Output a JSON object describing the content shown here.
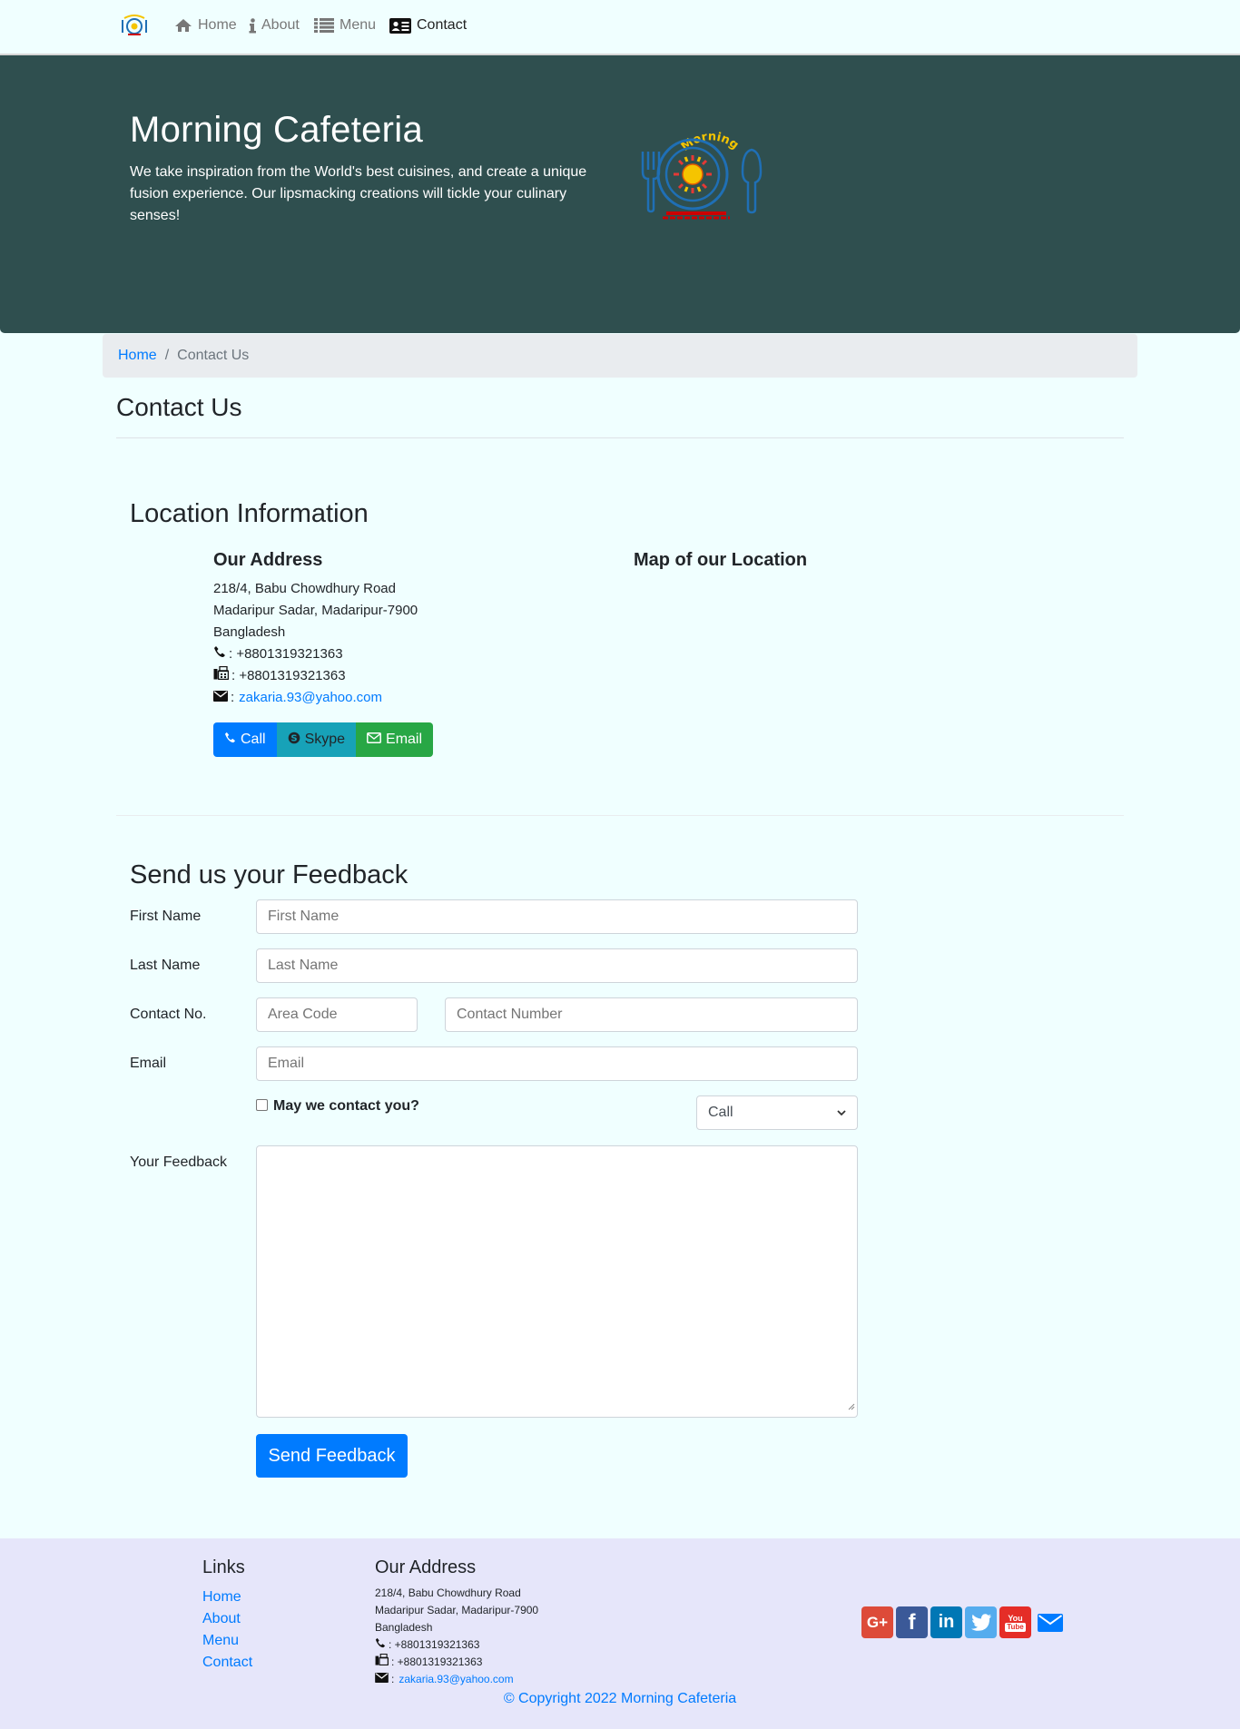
{
  "nav": {
    "items": [
      {
        "label": "Home",
        "icon": "home-icon"
      },
      {
        "label": "About",
        "icon": "info-icon"
      },
      {
        "label": "Menu",
        "icon": "list-icon"
      },
      {
        "label": "Contact",
        "icon": "address-card-icon",
        "active": true
      }
    ]
  },
  "hero": {
    "title": "Morning Cafeteria",
    "text": "We take inspiration from the World's best cuisines, and create a unique fusion experience. Our lipsmacking creations will tickle your culinary senses!",
    "logo_text": "Morning"
  },
  "breadcrumb": {
    "home": "Home",
    "current": "Contact Us"
  },
  "page_title": "Contact Us",
  "location": {
    "title": "Location Information",
    "address_title": "Our Address",
    "map_title": "Map of our Location",
    "line1": "218/4, Babu Chowdhury Road",
    "line2": "Madaripur Sadar, Madaripur-7900",
    "line3": "Bangladesh",
    "phone": ": +8801319321363",
    "fax": ": +8801319321363",
    "email_prefix": ":",
    "email": "zakaria.93@yahoo.com",
    "buttons": {
      "call": "Call",
      "skype": "Skype",
      "email": "Email"
    }
  },
  "feedback": {
    "title": "Send us your Feedback",
    "first_label": "First Name",
    "first_placeholder": "First Name",
    "last_label": "Last Name",
    "last_placeholder": "Last Name",
    "contact_label": "Contact No.",
    "area_placeholder": "Area Code",
    "number_placeholder": "Contact Number",
    "email_label": "Email",
    "email_placeholder": "Email",
    "checkbox_label": "May we contact you?",
    "select_value": "Call",
    "feedback_label": "Your Feedback",
    "submit": "Send Feedback"
  },
  "footer": {
    "links_title": "Links",
    "links": [
      "Home",
      "About",
      "Menu",
      "Contact"
    ],
    "address_title": "Our Address",
    "line1": "218/4, Babu Chowdhury Road",
    "line2": "Madaripur Sadar, Madaripur-7900",
    "line3": "Bangladesh",
    "phone": ": +8801319321363",
    "fax": ": +8801319321363",
    "email_prefix": ":",
    "email": "zakaria.93@yahoo.com",
    "social": [
      {
        "icon": "google-plus-icon",
        "color": "#dd4b39",
        "glyph": "G+"
      },
      {
        "icon": "facebook-icon",
        "color": "#3b5998",
        "glyph": "f"
      },
      {
        "icon": "linkedin-icon",
        "color": "#0077b5",
        "glyph": "in"
      },
      {
        "icon": "twitter-icon",
        "color": "#55acee",
        "glyph": "t"
      },
      {
        "icon": "youtube-icon",
        "color": "#e52d27",
        "glyph": "You"
      },
      {
        "icon": "envelope-icon",
        "color": "#007bff",
        "glyph": "✉"
      }
    ],
    "copyright": "© Copyright 2022 Morning Cafeteria"
  },
  "colors": {
    "hero_bg": "#2f4f4f",
    "page_bg": "#f0ffff",
    "footer_bg": "#e6e6fa",
    "primary": "#007bff",
    "info": "#17a2b8",
    "success": "#28a745"
  }
}
